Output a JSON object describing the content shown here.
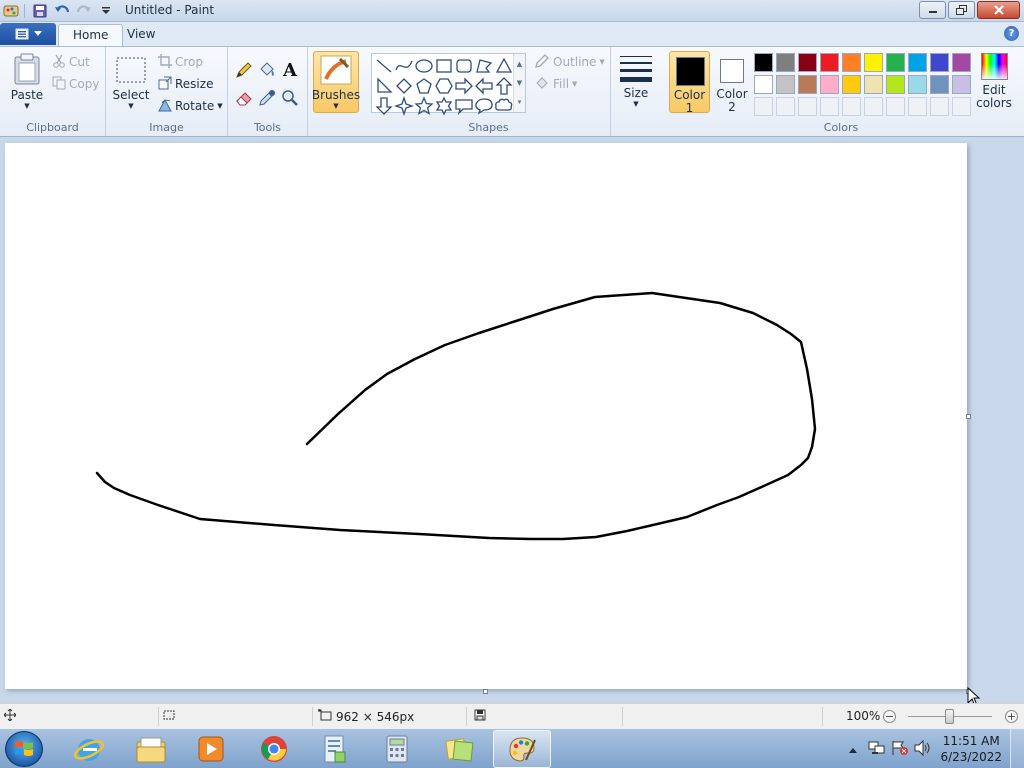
{
  "window": {
    "title": "Untitled - Paint"
  },
  "ribbon_tabs": [
    "Home",
    "View"
  ],
  "clipboard": {
    "paste_label": "Paste",
    "cut_label": "Cut",
    "copy_label": "Copy",
    "group_label": "Clipboard"
  },
  "image": {
    "select_label": "Select",
    "crop_label": "Crop",
    "resize_label": "Resize",
    "rotate_label": "Rotate",
    "group_label": "Image"
  },
  "tools": {
    "group_label": "Tools",
    "text_glyph": "A"
  },
  "brushes": {
    "label": "Brushes"
  },
  "shapes": {
    "outline_label": "Outline",
    "fill_label": "Fill",
    "group_label": "Shapes"
  },
  "size": {
    "label": "Size"
  },
  "color1": {
    "label_line1": "Color",
    "label_line2": "1",
    "value": "#000000"
  },
  "color2": {
    "label_line1": "Color",
    "label_line2": "2",
    "value": "#ffffff"
  },
  "colors": {
    "group_label": "Colors",
    "edit_label_line1": "Edit",
    "edit_label_line2": "colors",
    "palette_row1": [
      "#000000",
      "#7f7f7f",
      "#880015",
      "#ed1c24",
      "#ff7f27",
      "#fff200",
      "#22b14c",
      "#00a2e8",
      "#3f48cc",
      "#a349a4"
    ],
    "palette_row2": [
      "#ffffff",
      "#c3c3c3",
      "#b97a57",
      "#ffaec9",
      "#ffc90e",
      "#efe4b0",
      "#b5e61d",
      "#99d9ea",
      "#7092be",
      "#c8bfe7"
    ]
  },
  "status": {
    "canvas_size": "962 × 546px",
    "zoom": "100%"
  },
  "taskbar": {
    "time": "11:51 AM",
    "date": "6/23/2022"
  },
  "accent_colors": {
    "selected_button": "#f8c966",
    "ribbon_bg": "#e6edf7",
    "workspace_bg": "#c9d7ea"
  }
}
